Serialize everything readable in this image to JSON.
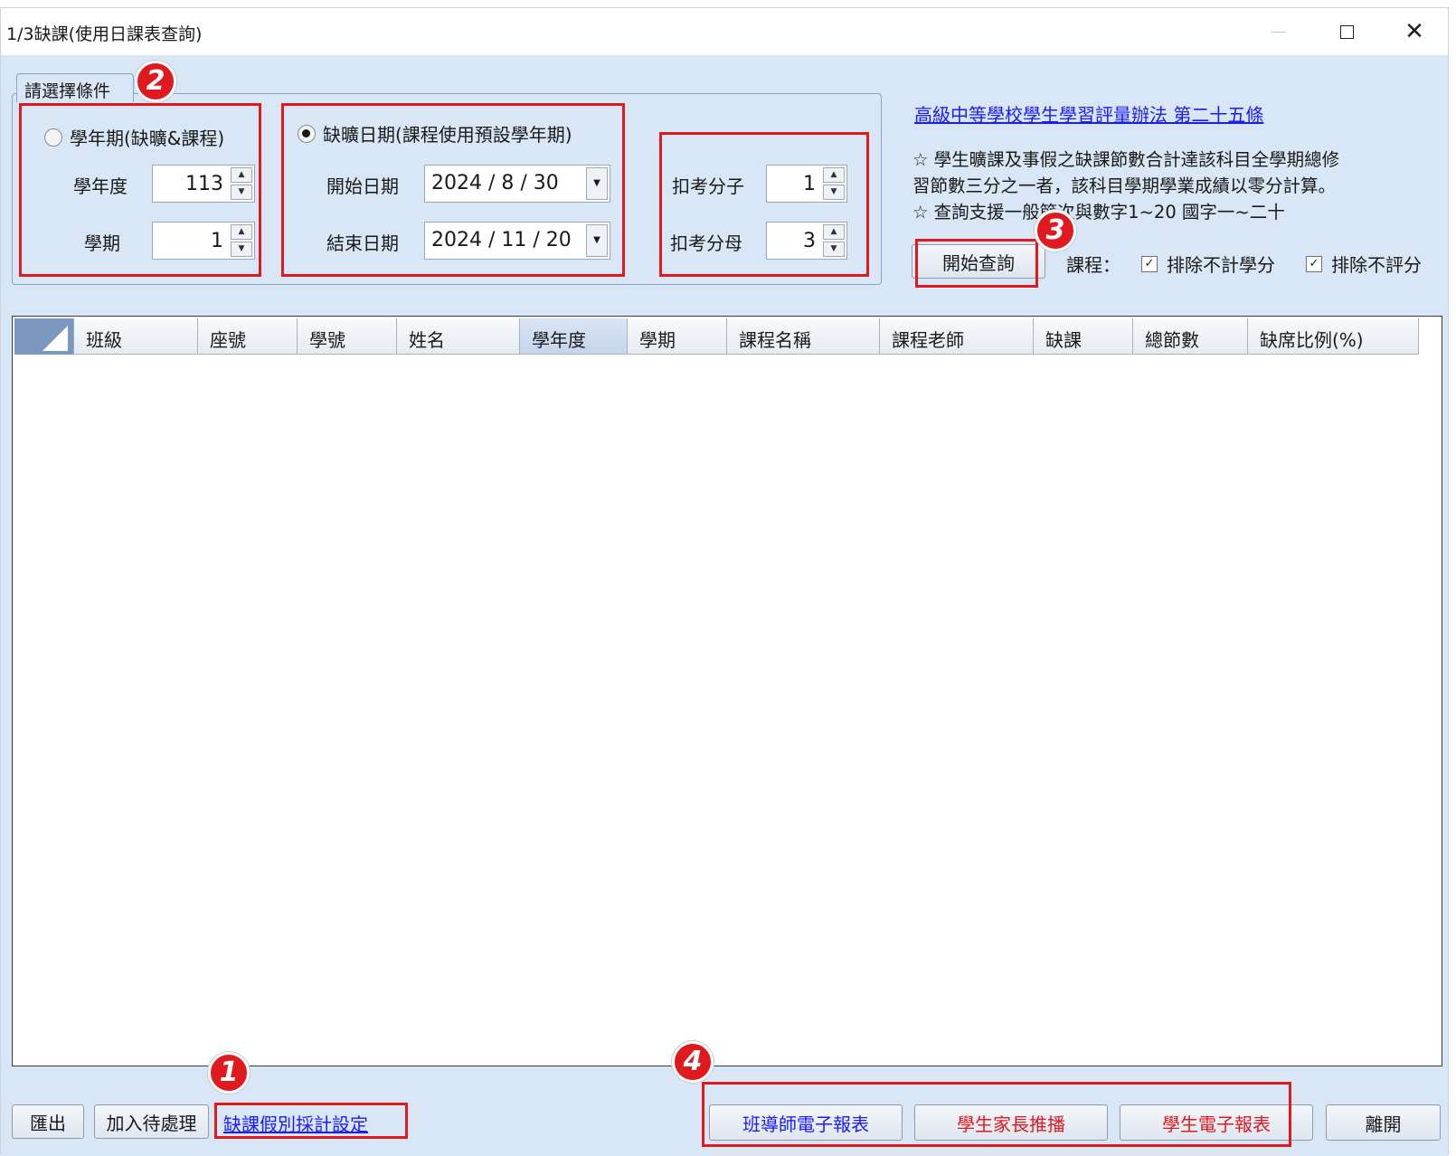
{
  "window": {
    "title": "1/3缺課(使用日課表查詢)"
  },
  "criteria": {
    "group_title": "請選擇條件",
    "semester_radio": "學年期(缺曠&課程)",
    "school_year_label": "學年度",
    "school_year_value": "113",
    "semester_label": "學期",
    "semester_value": "1",
    "date_radio": "缺曠日期(課程使用預設學年期)",
    "start_label": "開始日期",
    "start_value": "2024 / 8 / 30",
    "end_label": "結束日期",
    "end_value": "2024 / 11 / 20",
    "numerator_label": "扣考分子",
    "numerator_value": "1",
    "denominator_label": "扣考分母",
    "denominator_value": "3"
  },
  "info": {
    "law_link": "高級中等學校學生學習評量辦法 第二十五條",
    "note1": "☆ 學生曠課及事假之缺課節數合計達該科目全學期總修",
    "note2": "習節數三分之一者，該科目學期學業成績以零分計算。",
    "note3": "☆ 查詢支援一般節次與數字1~20 國字一~二十"
  },
  "query": {
    "start_button": "開始查詢",
    "course_label": "課程：",
    "exclude_credit": "排除不計學分",
    "exclude_score": "排除不評分"
  },
  "grid": {
    "columns": [
      "班級",
      "座號",
      "學號",
      "姓名",
      "學年度",
      "學期",
      "課程名稱",
      "課程老師",
      "缺課",
      "總節數",
      "缺席比例(%)"
    ]
  },
  "footer": {
    "export": "匯出",
    "add_pending": "加入待處理",
    "leave_settings": "缺課假別採計設定",
    "homeroom_report": "班導師電子報表",
    "parent_push": "學生家長推播",
    "student_report": "學生電子報表",
    "leave": "離開"
  },
  "badges": {
    "b1": "1",
    "b2": "2",
    "b3": "3",
    "b4": "4"
  },
  "colors": {
    "annotation_red": "#e0191f",
    "link_blue": "#1a1aff",
    "window_bg": "#d9e6f5"
  }
}
